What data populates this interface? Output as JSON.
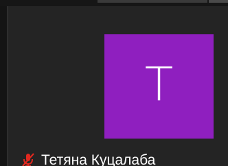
{
  "participant": {
    "initial": "T",
    "name": "Тетяна Куцалаба",
    "avatar_color": "#8f1fbf",
    "mic_status": "muted",
    "mic_icon": "muted-microphone-icon",
    "mic_icon_color": "#e0281f"
  }
}
